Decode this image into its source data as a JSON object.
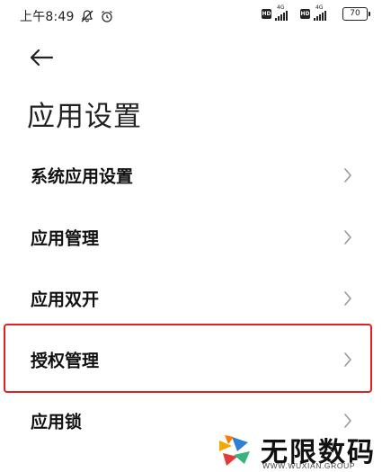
{
  "status_bar": {
    "time": "上午8:49",
    "network_1": "4G",
    "network_2": "4G",
    "hd_1": "HD",
    "hd_2": "HD",
    "battery": "70"
  },
  "header": {
    "back_icon": "arrow-left-icon",
    "title": "应用设置"
  },
  "menu": {
    "items": [
      {
        "label": "系统应用设置",
        "icon": "chevron-right-icon"
      },
      {
        "label": "应用管理",
        "icon": "chevron-right-icon"
      },
      {
        "label": "应用双开",
        "icon": "chevron-right-icon"
      },
      {
        "label": "授权管理",
        "icon": "chevron-right-icon",
        "highlighted": true
      },
      {
        "label": "应用锁",
        "icon": "chevron-right-icon"
      }
    ]
  },
  "watermark": {
    "title": "无限数码",
    "subtitle": "WWW.WUXIAN.GROUP"
  },
  "colors": {
    "highlight_border": "#e02020",
    "chevron": "#9a9a9a",
    "text": "#111111"
  }
}
